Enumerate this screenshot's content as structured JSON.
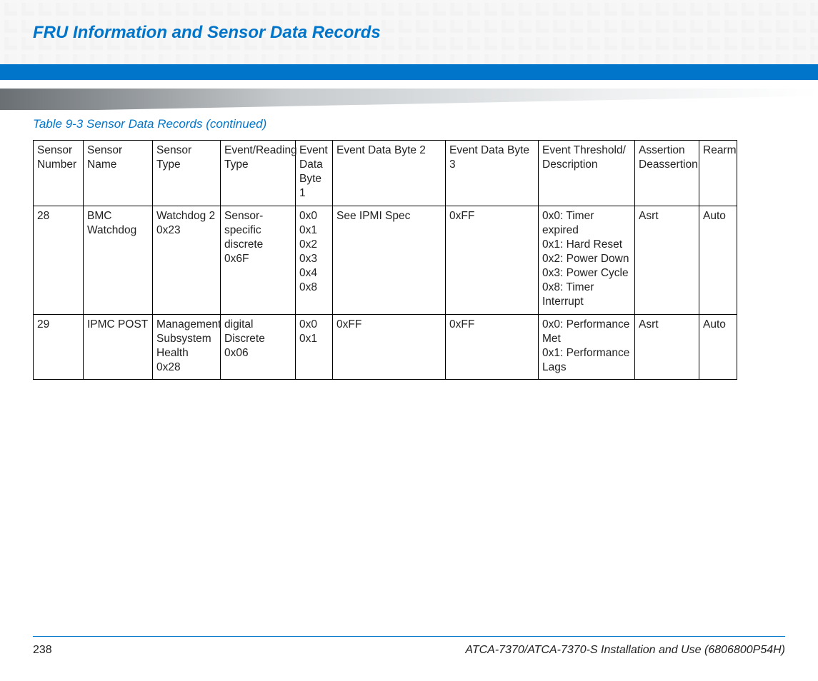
{
  "header": {
    "chapter_title": "FRU Information and Sensor Data Records"
  },
  "table": {
    "caption": "Table 9-3 Sensor Data Records  (continued)",
    "columns": [
      "Sensor Number",
      "Sensor Name",
      "Sensor Type",
      "Event/Reading Type",
      "Event Data Byte 1",
      "Event Data Byte 2",
      "Event Data Byte 3",
      "Event Threshold/ Description",
      "Assertion Deassertion",
      "Rearm"
    ],
    "rows": [
      {
        "sensor_number": "28",
        "sensor_name": "BMC Watchdog",
        "sensor_type": [
          "Watchdog 2",
          "0x23"
        ],
        "event_reading_type": [
          "Sensor-specific",
          "discrete",
          "0x6F"
        ],
        "event_data_byte1": [
          "0x0",
          "0x1",
          "0x2",
          "0x3",
          "0x4",
          "0x8"
        ],
        "event_data_byte2": "See IPMI Spec",
        "event_data_byte3": "0xFF",
        "threshold_desc": [
          "0x0: Timer expired",
          "0x1: Hard Reset",
          "0x2: Power Down",
          "0x3: Power Cycle",
          "0x8: Timer Interrupt"
        ],
        "assertion": "Asrt",
        "rearm": "Auto"
      },
      {
        "sensor_number": "29",
        "sensor_name": "IPMC POST",
        "sensor_type": [
          "Management",
          "Subsystem",
          "Health",
          "0x28"
        ],
        "event_reading_type": [
          "digital Discrete",
          "0x06"
        ],
        "event_data_byte1": [
          "0x0",
          "0x1"
        ],
        "event_data_byte2": "0xFF",
        "event_data_byte3": "0xFF",
        "threshold_desc": [
          "0x0: Performance Met",
          "0x1: Performance Lags"
        ],
        "assertion": "Asrt",
        "rearm": "Auto"
      }
    ]
  },
  "footer": {
    "page_number": "238",
    "doc_title": "ATCA-7370/ATCA-7370-S Installation and Use (6806800P54H)"
  }
}
